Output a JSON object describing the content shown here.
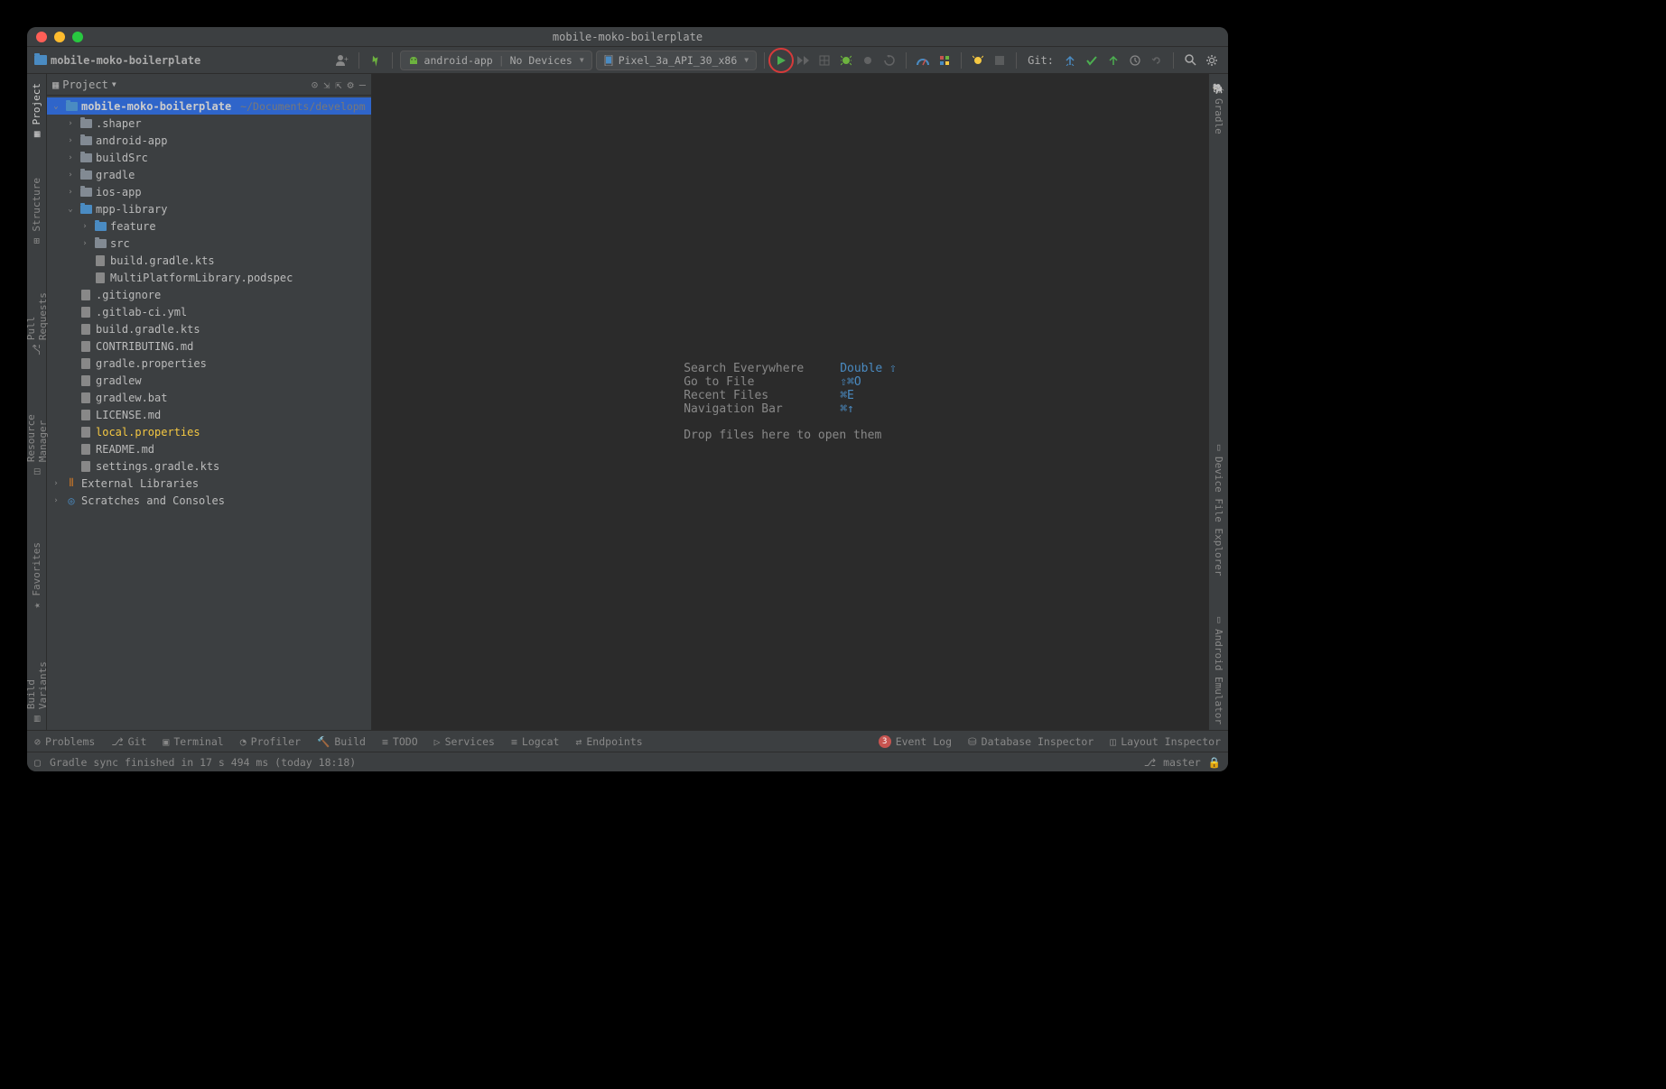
{
  "window": {
    "title": "mobile-moko-boilerplate"
  },
  "breadcrumb": {
    "project": "mobile-moko-boilerplate"
  },
  "toolbar": {
    "config1_app": "android-app",
    "config1_devices": "No Devices",
    "config2": "Pixel_3a_API_30_x86",
    "git_label": "Git:"
  },
  "left_gutter": [
    {
      "label": "Project"
    },
    {
      "label": "Structure"
    },
    {
      "label": "Pull Requests"
    },
    {
      "label": "Resource Manager"
    },
    {
      "label": "Favorites"
    },
    {
      "label": "Build Variants"
    }
  ],
  "right_gutter": [
    {
      "label": "Gradle"
    },
    {
      "label": "Device File Explorer"
    },
    {
      "label": "Android Emulator"
    }
  ],
  "panel": {
    "title": "Project"
  },
  "tree": {
    "root": {
      "name": "mobile-moko-boilerplate",
      "path": "~/Documents/developm"
    },
    "items": [
      {
        "indent": 1,
        "expand": "›",
        "icon": "folder",
        "label": ".shaper"
      },
      {
        "indent": 1,
        "expand": "›",
        "icon": "folder",
        "label": "android-app"
      },
      {
        "indent": 1,
        "expand": "›",
        "icon": "folder",
        "label": "buildSrc"
      },
      {
        "indent": 1,
        "expand": "›",
        "icon": "folder",
        "label": "gradle"
      },
      {
        "indent": 1,
        "expand": "›",
        "icon": "folder",
        "label": "ios-app"
      },
      {
        "indent": 1,
        "expand": "⌄",
        "icon": "folder-blue",
        "label": "mpp-library"
      },
      {
        "indent": 2,
        "expand": "›",
        "icon": "folder-blue",
        "label": "feature"
      },
      {
        "indent": 2,
        "expand": "›",
        "icon": "folder",
        "label": "src"
      },
      {
        "indent": 2,
        "expand": "",
        "icon": "file",
        "label": "build.gradle.kts"
      },
      {
        "indent": 2,
        "expand": "",
        "icon": "file",
        "label": "MultiPlatformLibrary.podspec"
      },
      {
        "indent": 1,
        "expand": "",
        "icon": "file",
        "label": ".gitignore"
      },
      {
        "indent": 1,
        "expand": "",
        "icon": "file",
        "label": ".gitlab-ci.yml"
      },
      {
        "indent": 1,
        "expand": "",
        "icon": "file",
        "label": "build.gradle.kts"
      },
      {
        "indent": 1,
        "expand": "",
        "icon": "file",
        "label": "CONTRIBUTING.md"
      },
      {
        "indent": 1,
        "expand": "",
        "icon": "file",
        "label": "gradle.properties"
      },
      {
        "indent": 1,
        "expand": "",
        "icon": "file",
        "label": "gradlew"
      },
      {
        "indent": 1,
        "expand": "",
        "icon": "file",
        "label": "gradlew.bat"
      },
      {
        "indent": 1,
        "expand": "",
        "icon": "file",
        "label": "LICENSE.md"
      },
      {
        "indent": 1,
        "expand": "",
        "icon": "file",
        "label": "local.properties",
        "highlight": true
      },
      {
        "indent": 1,
        "expand": "",
        "icon": "file",
        "label": "README.md"
      },
      {
        "indent": 1,
        "expand": "",
        "icon": "file",
        "label": "settings.gradle.kts"
      }
    ],
    "extlib": "External Libraries",
    "scratches": "Scratches and Consoles"
  },
  "placeholder": {
    "rows": [
      {
        "label": "Search Everywhere",
        "shortcut": "Double ⇧"
      },
      {
        "label": "Go to File",
        "shortcut": "⇧⌘O"
      },
      {
        "label": "Recent Files",
        "shortcut": "⌘E"
      },
      {
        "label": "Navigation Bar",
        "shortcut": "⌘↑"
      }
    ],
    "drop": "Drop files here to open them"
  },
  "bottom_tools": {
    "left": [
      {
        "label": "Problems",
        "icon": "⊘"
      },
      {
        "label": "Git",
        "icon": "⎇"
      },
      {
        "label": "Terminal",
        "icon": "▣"
      },
      {
        "label": "Profiler",
        "icon": "◔"
      },
      {
        "label": "Build",
        "icon": "🔨"
      },
      {
        "label": "TODO",
        "icon": "≡"
      },
      {
        "label": "Services",
        "icon": "▷"
      },
      {
        "label": "Logcat",
        "icon": "≡"
      },
      {
        "label": "Endpoints",
        "icon": "⇄"
      }
    ],
    "right": [
      {
        "label": "Event Log",
        "badge": "3"
      },
      {
        "label": "Database Inspector",
        "icon": "⛁"
      },
      {
        "label": "Layout Inspector",
        "icon": "◫"
      }
    ]
  },
  "status": {
    "message": "Gradle sync finished in 17 s 494 ms (today 18:18)",
    "branch": "master"
  }
}
